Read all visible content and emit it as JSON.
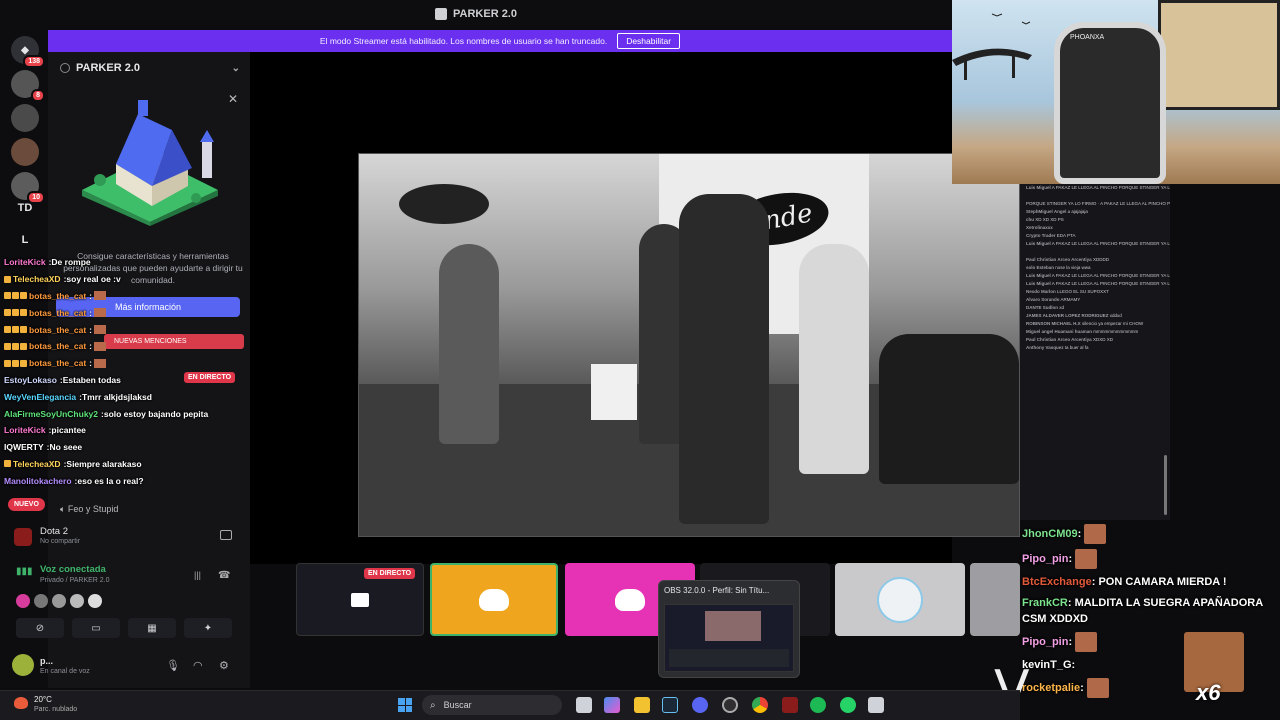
{
  "window": {
    "title": "PARKER 2.0"
  },
  "banner": {
    "text": "El modo Streamer está habilitado. Los nombres de usuario se han truncado.",
    "action": "Deshabilitar"
  },
  "rail": {
    "badges": [
      "138",
      "8",
      "10"
    ],
    "text_servers": [
      "TD",
      "L"
    ]
  },
  "server": {
    "name": "PARKER 2.0"
  },
  "promo": {
    "text": "Consigue características y herramientas personalizadas que pueden ayudarte a dirigir tu comunidad.",
    "button": "Más información",
    "mentions": "NUEVAS MENCIONES",
    "live_badge": "EN DIRECTO",
    "nuevo_badge": "NUEVO",
    "channel_label": "Feo y Stupid"
  },
  "chat_left": [
    {
      "user": "LoriteKick",
      "color": "#ff7ad0",
      "msg": "De rompe",
      "icons": 0,
      "emote": false
    },
    {
      "user": "TelecheaXD",
      "color": "#ffd35a",
      "msg": "soy real oe :v",
      "icons": 1,
      "emote": false
    },
    {
      "user": "botas_the_cat",
      "color": "#ff9a3c",
      "msg": "",
      "icons": 3,
      "emote": true
    },
    {
      "user": "botas_the_cat",
      "color": "#ff9a3c",
      "msg": "",
      "icons": 3,
      "emote": true
    },
    {
      "user": "botas_the_cat",
      "color": "#ff9a3c",
      "msg": "",
      "icons": 3,
      "emote": true
    },
    {
      "user": "botas_the_cat",
      "color": "#ff9a3c",
      "msg": "",
      "icons": 3,
      "emote": true
    },
    {
      "user": "botas_the_cat",
      "color": "#ff9a3c",
      "msg": "",
      "icons": 3,
      "emote": true
    },
    {
      "user": "EstoyLokaso",
      "color": "#cfd8ff",
      "msg": "Estaben todas",
      "icons": 0,
      "emote": false
    },
    {
      "user": "WeyVenElegancia",
      "color": "#5ad7ff",
      "msg": "Tmrr alkjdsjlaksd",
      "icons": 0,
      "emote": false
    },
    {
      "user": "AlaFirmeSoyUnChuky2",
      "color": "#5ee27a",
      "msg": "solo estoy bajando pepita",
      "icons": 0,
      "emote": false
    },
    {
      "user": "LoriteKick",
      "color": "#ff7ad0",
      "msg": "picantee",
      "icons": 0,
      "emote": false
    },
    {
      "user": "IQWERTY",
      "color": "#ffffff",
      "msg": "No seee",
      "icons": 0,
      "emote": false
    },
    {
      "user": "TelecheaXD",
      "color": "#ffd35a",
      "msg": "Siempre alarakaso",
      "icons": 1,
      "emote": false
    },
    {
      "user": "Manolitokachero",
      "color": "#b48cff",
      "msg": "eso es la o real?",
      "icons": 0,
      "emote": false
    }
  ],
  "game": {
    "title": "Dota 2",
    "sub": "No compartir"
  },
  "voice": {
    "title": "Voz conectada",
    "sub": "Privado / PARKER 2.0"
  },
  "user": {
    "name": "p...",
    "status": "En canal de voz"
  },
  "tiles": {
    "live_badge": "EN DIRECTO"
  },
  "obs": {
    "title": "OBS 32.0.0 - Perfil: Sin Títu..."
  },
  "webcam": {
    "chair_brand": "PHOANXA"
  },
  "chat_right": [
    {
      "user": "Luis Miguel",
      "msg": "A PAKAZ LE LLEGA AL PINCHO PORQUE STINGER YA LO FIRMO"
    },
    {
      "user": "",
      "msg": "PORQUE STINGER YA LO FIRMO · A PAKAZ LE LLEGA AL PINCHO PORQUE STINGER YA LO FIRMO"
    },
    {
      "user": "StephMiguel Angel a",
      "msg": "ajajajaja"
    },
    {
      "user": "chu",
      "msg": "XD XD XD PS"
    },
    {
      "user": "Xetrolinaxxx",
      "msg": ""
    },
    {
      "user": "Crypto Trader",
      "msg": "EDA PTA"
    },
    {
      "user": "Luis Miguel",
      "msg": "A PAKAZ LE LLEGA AL PINCHO PORQUE STINGER YA LO FIRMO"
    },
    {
      "user": "Paul Christian Arceo Arcentiya",
      "msg": "XDDDD"
    },
    {
      "user": "solo Esteban",
      "msg": "nose la vieja wwa"
    },
    {
      "user": "Luis Miguel",
      "msg": "A PAKAZ LE LLEGA AL PINCHO PORQUE STINGER YA LO FIRMO"
    },
    {
      "user": "Luis Miguel",
      "msg": "A PAKAZ LE LLEGA AL PINCHO PORQUE STINGER YA LO FIRMO"
    },
    {
      "user": "Nexdo Marlon",
      "msg": "LLEGO EL SU SUPOXXT"
    },
    {
      "user": "Alvaro Sorando",
      "msg": "ARMAMY"
    },
    {
      "user": "DANTE Sudlon",
      "msg": "xd"
    },
    {
      "user": "JAMES ALDAVER LOPEZ RODRIGUEZ",
      "msg": "xddxd"
    },
    {
      "user": "ROBINSON MICHAEL H.X",
      "msg": "silencio ya empezar mi CHOW"
    },
    {
      "user": "Miguel angel Huamani huaman",
      "msg": "mmmmmmmmmmmm"
    },
    {
      "user": "Paul Christian Arceo Arcentiya",
      "msg": "XDXD XD"
    },
    {
      "user": "Anthony Vasquez",
      "msg": "ta buer al fa"
    }
  ],
  "chat_overlay": [
    {
      "user": "JhonCM09",
      "color": "#7de38f",
      "msg": "",
      "emote": true
    },
    {
      "user": "Pipo_pin",
      "color": "#f3a0e6",
      "msg": "",
      "emote": true
    },
    {
      "user": "BtcExchange",
      "color": "#e25a3a",
      "msg": "PON CAMARA MIERDA !",
      "emote": false
    },
    {
      "user": "FrankCR",
      "color": "#7de38f",
      "msg": "MALDITA LA SUEGRA APAÑADORA CSM XDDXD",
      "emote": false
    },
    {
      "user": "Pipo_pin",
      "color": "#f3a0e6",
      "msg": "",
      "emote": true
    },
    {
      "user": "kevinT_G",
      "color": "#ffffff",
      "msg": "",
      "emote": false
    },
    {
      "user": "rocketpalie",
      "color": "#ffb54a",
      "msg": "",
      "emote": true
    }
  ],
  "x6": "x6",
  "bigV": "V",
  "taskbar": {
    "temp": "20°C",
    "weather": "Parc. nublado",
    "search": "Buscar"
  },
  "colors": {
    "accent": "#6b2ff0",
    "blurple": "#5865f2",
    "live": "#e0364a",
    "voice": "#3fb36a",
    "tile_orange": "#f0a51e",
    "tile_pink": "#e632b4"
  }
}
